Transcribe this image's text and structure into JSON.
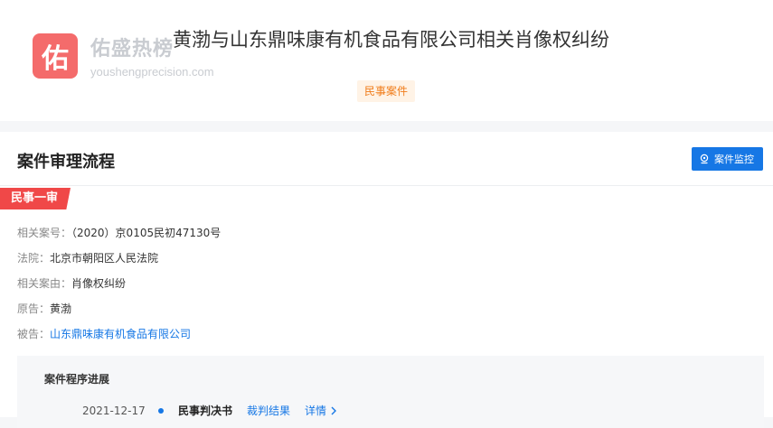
{
  "brand": {
    "logo_glyph": "佑",
    "name": "佑盛热榜",
    "domain": "youshengprecision.com",
    "logo_color": "#f35b5b"
  },
  "case": {
    "title": "黄渤与山东鼎味康有机食品有限公司相关肖像权纠纷",
    "tag": "民事案件"
  },
  "panel": {
    "title": "案件审理流程",
    "monitor_button": "案件监控",
    "monitor_icon": "location-pin-icon",
    "stage": "民事一审",
    "fields": [
      {
        "label": "相关案号：",
        "value": "（2020）京0105民初47130号"
      },
      {
        "label": "法院：",
        "value": "北京市朝阳区人民法院"
      },
      {
        "label": "相关案由：",
        "value": "肖像权纠纷"
      },
      {
        "label": "原告：",
        "value": "黄渤"
      },
      {
        "label": "被告：",
        "value": "山东鼎味康有机食品有限公司"
      }
    ]
  },
  "progress": {
    "title": "案件程序进展",
    "items": [
      {
        "date": "2021-12-17",
        "document": "民事判决书",
        "result_link": "裁判结果",
        "detail_link": "详情"
      }
    ]
  },
  "colors": {
    "accent": "#1677e5",
    "stage_red": "#f04848",
    "tag_orange": "#f07c1a"
  }
}
